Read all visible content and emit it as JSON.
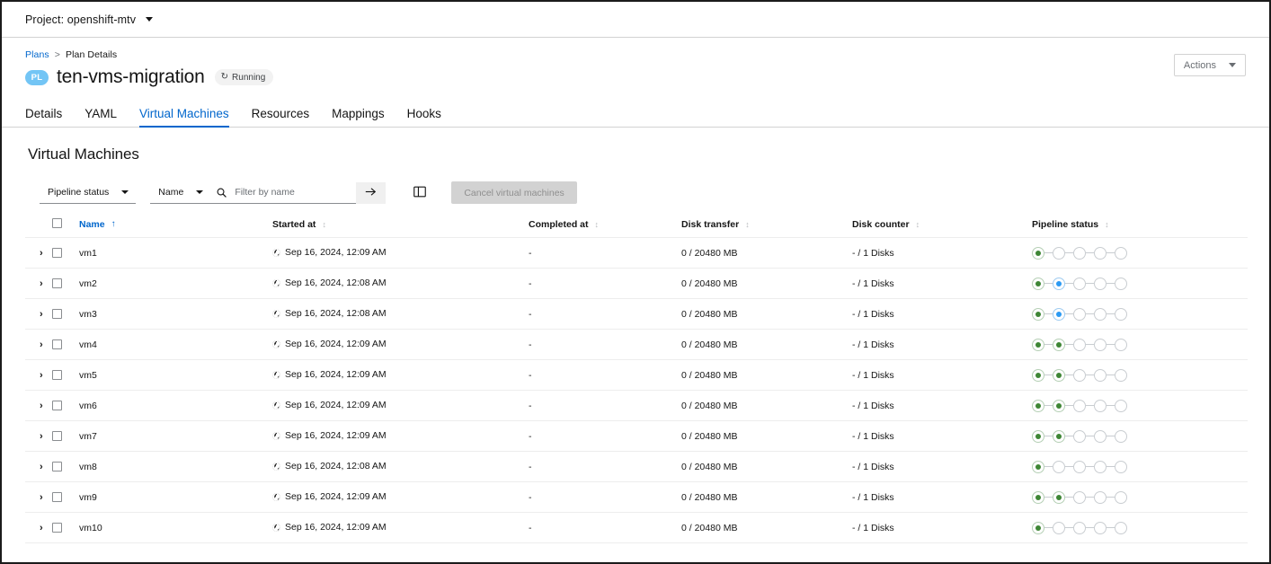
{
  "project_bar": {
    "label": "Project: openshift-mtv",
    "caret_icon": "chevron-down-icon"
  },
  "breadcrumb": {
    "root": "Plans",
    "separator": ">",
    "current": "Plan Details"
  },
  "header": {
    "badge": "PL",
    "title": "ten-vms-migration",
    "status": "Running",
    "status_icon": "sync-icon",
    "actions_label": "Actions"
  },
  "tabs": [
    {
      "label": "Details",
      "active": false
    },
    {
      "label": "YAML",
      "active": false
    },
    {
      "label": "Virtual Machines",
      "active": true
    },
    {
      "label": "Resources",
      "active": false
    },
    {
      "label": "Mappings",
      "active": false
    },
    {
      "label": "Hooks",
      "active": false
    }
  ],
  "section": {
    "title": "Virtual Machines"
  },
  "toolbar": {
    "status_filter": "Pipeline status",
    "attribute_filter": "Name",
    "search_placeholder": "Filter by name",
    "search_value": "",
    "search_icon": "search-icon",
    "submit_icon": "arrow-right-icon",
    "columns_icon": "column-management-icon",
    "cancel_label": "Cancel virtual machines"
  },
  "table": {
    "columns": [
      {
        "key": "name",
        "label": "Name",
        "sorted": true,
        "sort_dir": "asc"
      },
      {
        "key": "started_at",
        "label": "Started at",
        "sorted": false
      },
      {
        "key": "completed_at",
        "label": "Completed at",
        "sorted": false
      },
      {
        "key": "disk_transfer",
        "label": "Disk transfer",
        "sorted": false
      },
      {
        "key": "disk_counter",
        "label": "Disk counter",
        "sorted": false
      },
      {
        "key": "pipeline_status",
        "label": "Pipeline status",
        "sorted": false
      }
    ],
    "pipeline_steps": 5,
    "rows": [
      {
        "name": "vm1",
        "started_at": "Sep 16, 2024, 12:09 AM",
        "completed_at": "-",
        "disk_transfer": "0 / 20480 MB",
        "disk_counter": "- / 1 Disks",
        "pipeline": [
          "done",
          "pending",
          "pending",
          "pending",
          "pending"
        ]
      },
      {
        "name": "vm2",
        "started_at": "Sep 16, 2024, 12:08 AM",
        "completed_at": "-",
        "disk_transfer": "0 / 20480 MB",
        "disk_counter": "- / 1 Disks",
        "pipeline": [
          "done",
          "active",
          "pending",
          "pending",
          "pending"
        ]
      },
      {
        "name": "vm3",
        "started_at": "Sep 16, 2024, 12:08 AM",
        "completed_at": "-",
        "disk_transfer": "0 / 20480 MB",
        "disk_counter": "- / 1 Disks",
        "pipeline": [
          "done",
          "active",
          "pending",
          "pending",
          "pending"
        ]
      },
      {
        "name": "vm4",
        "started_at": "Sep 16, 2024, 12:09 AM",
        "completed_at": "-",
        "disk_transfer": "0 / 20480 MB",
        "disk_counter": "- / 1 Disks",
        "pipeline": [
          "done",
          "done",
          "pending",
          "pending",
          "pending"
        ]
      },
      {
        "name": "vm5",
        "started_at": "Sep 16, 2024, 12:09 AM",
        "completed_at": "-",
        "disk_transfer": "0 / 20480 MB",
        "disk_counter": "- / 1 Disks",
        "pipeline": [
          "done",
          "done",
          "pending",
          "pending",
          "pending"
        ]
      },
      {
        "name": "vm6",
        "started_at": "Sep 16, 2024, 12:09 AM",
        "completed_at": "-",
        "disk_transfer": "0 / 20480 MB",
        "disk_counter": "- / 1 Disks",
        "pipeline": [
          "done",
          "done",
          "pending",
          "pending",
          "pending"
        ]
      },
      {
        "name": "vm7",
        "started_at": "Sep 16, 2024, 12:09 AM",
        "completed_at": "-",
        "disk_transfer": "0 / 20480 MB",
        "disk_counter": "- / 1 Disks",
        "pipeline": [
          "done",
          "done",
          "pending",
          "pending",
          "pending"
        ]
      },
      {
        "name": "vm8",
        "started_at": "Sep 16, 2024, 12:08 AM",
        "completed_at": "-",
        "disk_transfer": "0 / 20480 MB",
        "disk_counter": "- / 1 Disks",
        "pipeline": [
          "done",
          "pending",
          "pending",
          "pending",
          "pending"
        ]
      },
      {
        "name": "vm9",
        "started_at": "Sep 16, 2024, 12:09 AM",
        "completed_at": "-",
        "disk_transfer": "0 / 20480 MB",
        "disk_counter": "- / 1 Disks",
        "pipeline": [
          "done",
          "done",
          "pending",
          "pending",
          "pending"
        ]
      },
      {
        "name": "vm10",
        "started_at": "Sep 16, 2024, 12:09 AM",
        "completed_at": "-",
        "disk_transfer": "0 / 20480 MB",
        "disk_counter": "- / 1 Disks",
        "pipeline": [
          "done",
          "pending",
          "pending",
          "pending",
          "pending"
        ]
      }
    ]
  },
  "colors": {
    "link": "#0066cc",
    "done": "#3e8635",
    "active": "#2b9af3",
    "pending": "#c9cdd1",
    "badge": "#73c5f5"
  }
}
